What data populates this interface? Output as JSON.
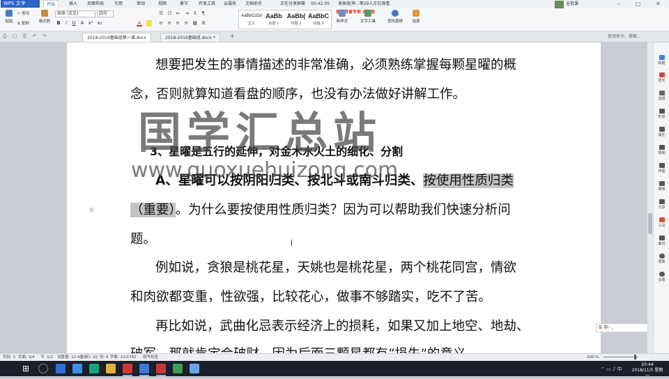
{
  "app": {
    "logo": "WPS 文字"
  },
  "menu": [
    "开始",
    "插入",
    "页面布局",
    "引用",
    "审阅",
    "视图",
    "章节",
    "开发工具",
    "云服务",
    "文档助手"
  ],
  "recording": {
    "status": "正在分享屏幕",
    "timer": "00:42:05"
  },
  "live": {
    "title": "斛斛乾坤...等29人正在观看",
    "subtitle": "留最背着专家 本注册"
  },
  "user": {
    "name": "全批课"
  },
  "ribbon": {
    "paste": "粘贴",
    "cut": "剪切",
    "copy": "复制",
    "format_painter": "格式刷",
    "font_name": "宋体 (正文)",
    "font_size": "四号",
    "format_buttons": [
      "B",
      "I",
      "U",
      "A",
      "x²",
      "x₂",
      "A"
    ],
    "styles": [
      {
        "sample": "AaBbCcDd",
        "name": "正文"
      },
      {
        "sample": "AaBb",
        "name": "标题 1"
      },
      {
        "sample": "AaBb(",
        "name": "标题 2"
      },
      {
        "sample": "AaBbC",
        "name": "标题 3"
      }
    ],
    "new_style": "新样式",
    "text_tools": "文字工具",
    "find_replace": "查找替换",
    "select": "选择"
  },
  "tabs": [
    {
      "label": "2018-2019基础班第一课.docx"
    },
    {
      "label": "2018-2019基础班.docx *"
    }
  ],
  "search_placeholder": "查找命令、搜索...",
  "document": {
    "p1_line1": "想要把发生的事情描述的非常准确，必须熟练掌握每颗星曜的概",
    "p1_line2": "念，否则就算知道看盘的顺序，也没有办法做好讲解工作。",
    "heading": "3、星曜是五行的延伸，对金木水火土的细化、分割",
    "pA_line1_plain": "A、星曜可以按阴阳归类、按北斗或南斗归类、",
    "pA_line1_highlight": "按使用性质归类",
    "pA_line2_highlight": "（重要）",
    "pA_line2_plain": "。为什么要按使用性质归类？因为可以帮助我们快速分析问",
    "pA_line3": "题。",
    "p2_line1": "例如说，贪狼是桃花星，天姚也是桃花星，两个桃花同宫，情欲",
    "p2_line2": "和肉欲都变重，性欲强，比较花心，做事不够踏实，吃不了苦。",
    "p3_line1": "再比如说，武曲化忌表示经济上的损耗，如果又加上地空、地劫、",
    "p3_line2": "破军，那就肯定会破财，因为后面三颗星都有“损失”的意义。"
  },
  "watermark": {
    "text": "国学汇总站",
    "url": "www.guoxuehuizong.com"
  },
  "right_panel": [
    "新建",
    "样式",
    "选择",
    "形状",
    "属性",
    "限制",
    "传图",
    "推荐",
    "分享",
    "工具",
    "备份",
    "帮助",
    "设置"
  ],
  "ime": "中 ·,",
  "status": {
    "page_num": "页码: 3",
    "pages": "页面: 3/4",
    "section": "节: 1/1",
    "setting": "设置值: 12.4厘米",
    "row": "行: 10",
    "col": "列: 6",
    "words": "字数: 12/1742",
    "spell": "拼写检查",
    "zoom": "200 %"
  },
  "clock": {
    "time": "20:44",
    "date": "2018/11/5 星期一"
  },
  "colors": {
    "accent": "#2b62c6",
    "taskbar": "#1b1f2a",
    "highlight": "#c3c3c3"
  }
}
